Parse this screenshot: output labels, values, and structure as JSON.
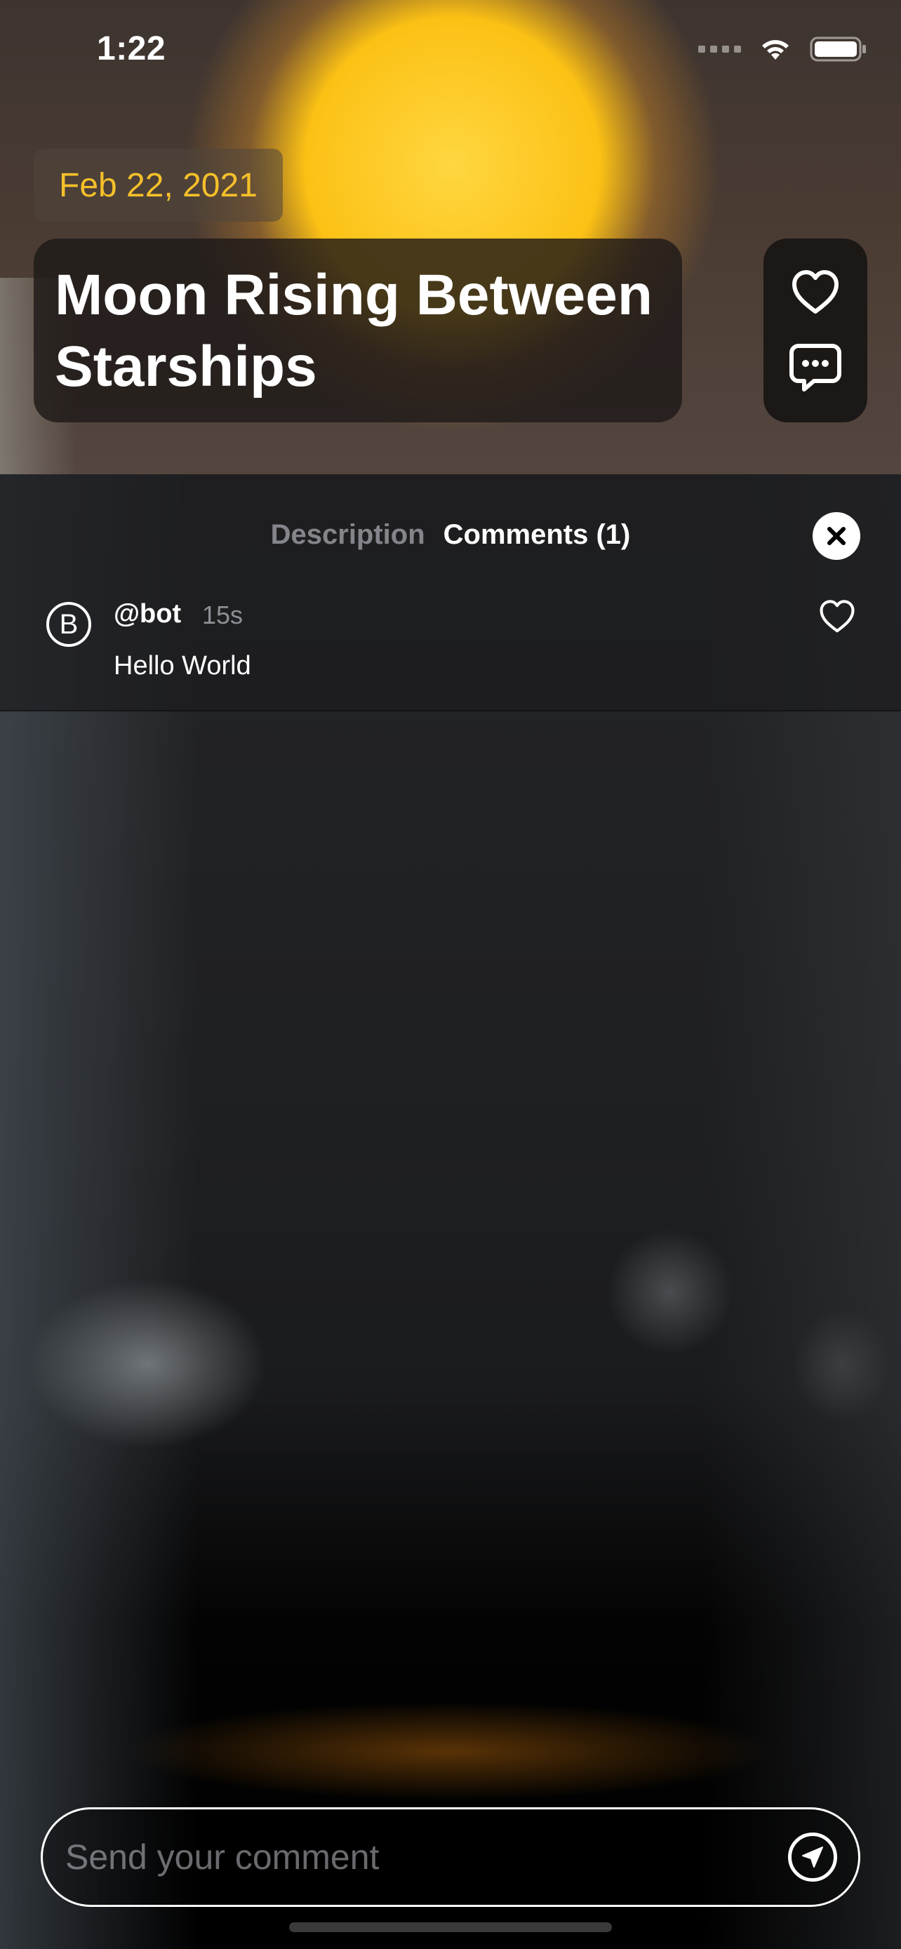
{
  "status_bar": {
    "time": "1:22",
    "icons": [
      "signal-icon",
      "wifi-icon",
      "battery-icon"
    ]
  },
  "post": {
    "date": "Feb 22, 2021",
    "title_line1": "Moon Rising Between",
    "title_line2": "Starships",
    "actions": [
      "heart-icon",
      "comment-bubble-icon"
    ]
  },
  "tabs": {
    "description_label": "Description",
    "comments_label": "Comments (1)",
    "active": "comments"
  },
  "comments": [
    {
      "avatar_letter": "B",
      "author": "@bot",
      "time": "15s",
      "text": "Hello World"
    }
  ],
  "composer": {
    "placeholder": "Send your comment",
    "value": ""
  },
  "colors": {
    "accent": "#f5c02a",
    "text_primary": "#ffffff",
    "text_secondary": "#8e8e93"
  }
}
